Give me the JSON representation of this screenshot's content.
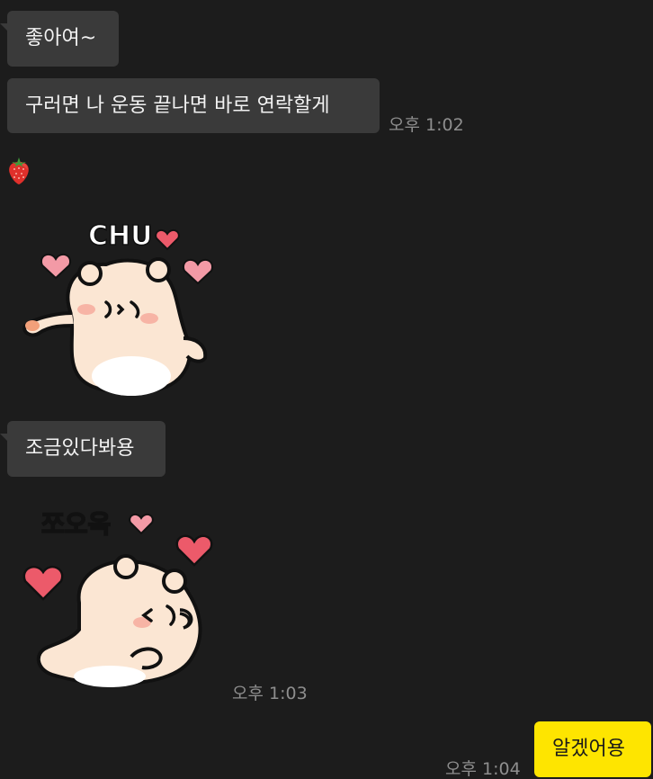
{
  "messages": {
    "m1": {
      "text": "좋아여~"
    },
    "m2": {
      "text": "구러면 나 운동 끝나면 바로 연락할게",
      "time": "오후 1:02"
    },
    "m3": {
      "emoji": "strawberry-emoji"
    },
    "m4": {
      "sticker_caption": "CHU",
      "sticker": "bear-kiss-sticker"
    },
    "m5": {
      "text": "조금있다봐용"
    },
    "m6": {
      "sticker_caption": "쪼오옥",
      "sticker": "bear-blowing-kiss-sticker",
      "time": "오후 1:03"
    },
    "m7": {
      "text": "알겠어용",
      "time": "오후 1:04"
    }
  },
  "colors": {
    "background": "#1c1c1c",
    "incoming_bubble": "#3a3a3a",
    "outgoing_bubble": "#fee500",
    "timestamp": "#8e8e8e"
  }
}
